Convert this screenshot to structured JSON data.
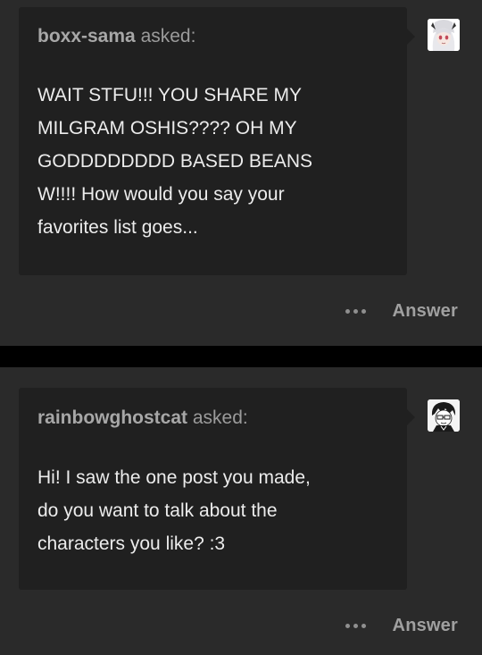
{
  "posts": [
    {
      "asker": "boxx-sama",
      "asked_label": "asked:",
      "question": "WAIT STFU!!! YOU SHARE MY\nMILGRAM OSHIS???? OH MY\nGODDDDDDDD BASED BEANS\nW!!!! How would you say your\nfavorites list goes...",
      "more_icon": "ellipsis-icon",
      "answer_label": "Answer",
      "avatar_icon": "white-haired-anime-avatar"
    },
    {
      "asker": "rainbowghostcat",
      "asked_label": "asked:",
      "question": "Hi! I saw the one post you made,\ndo you want to talk about the\ncharacters you like? :3",
      "more_icon": "ellipsis-icon",
      "answer_label": "Answer",
      "avatar_icon": "manga-character-avatar"
    }
  ],
  "colors": {
    "post_background": "#2a2a2a",
    "bubble_background": "#202020",
    "separator": "#000000",
    "question_text": "#ececec",
    "muted_text": "#a7a7a7"
  }
}
